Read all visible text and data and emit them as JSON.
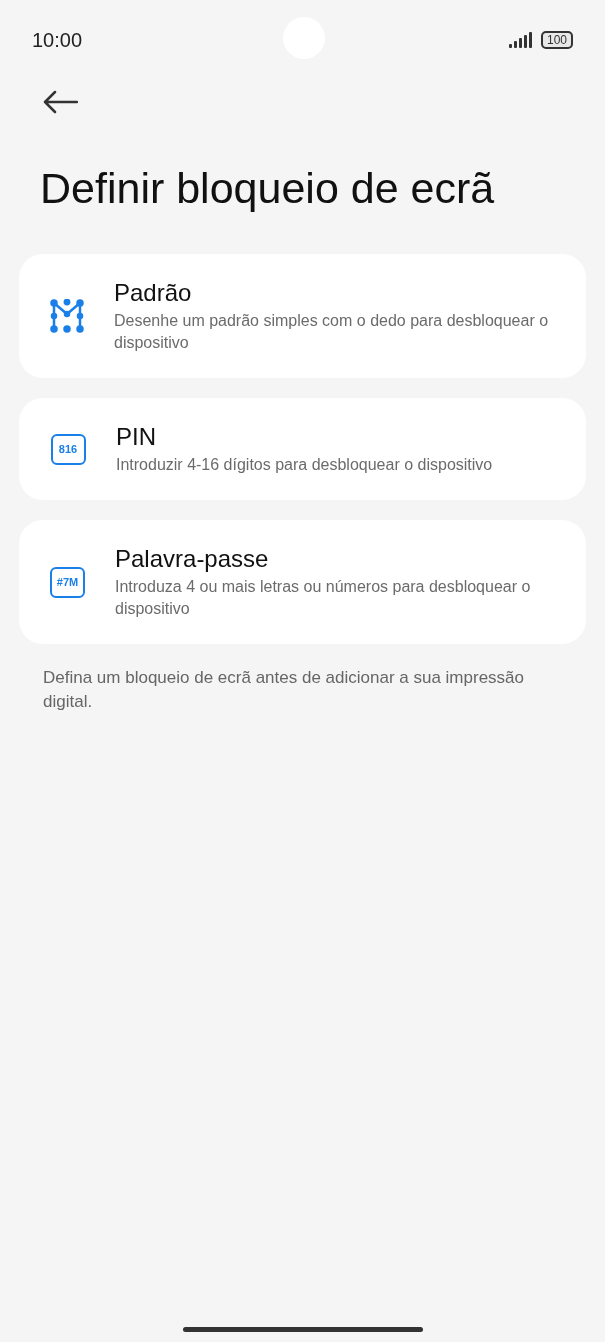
{
  "status_bar": {
    "time": "10:00",
    "battery": "100"
  },
  "title": "Definir bloqueio de ecrã",
  "options": [
    {
      "kind": "pattern",
      "title": "Padrão",
      "description": "Desenhe um padrão simples com o dedo para desbloquear o dispositivo"
    },
    {
      "kind": "pin",
      "icon_text": "816",
      "title": "PIN",
      "description": "Introduzir 4-16 dígitos para desbloquear o dispositivo"
    },
    {
      "kind": "password",
      "icon_text": "#7M",
      "title": "Palavra-passe",
      "description": "Introduza 4 ou mais letras ou números para desbloquear o dispositivo"
    }
  ],
  "footer": "Defina um bloqueio de ecrã antes de adicionar a sua impressão digital."
}
